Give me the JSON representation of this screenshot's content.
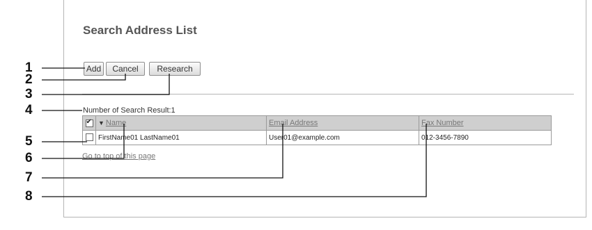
{
  "page": {
    "title": "Search Address List",
    "buttons": {
      "add": "Add",
      "cancel": "Cancel",
      "research": "Research"
    },
    "result_count": "Number of Search Result:1",
    "table": {
      "headers": {
        "name": "Name",
        "email": "Email Address",
        "fax": "Fax Number"
      },
      "rows": [
        {
          "name": "FirstName01 LastName01",
          "email": "User01@example.com",
          "fax": "012-3456-7890"
        }
      ]
    },
    "go_to_top": "Go to top of this page"
  },
  "callouts": [
    "1",
    "2",
    "3",
    "4",
    "5",
    "6",
    "7",
    "8"
  ],
  "colors": {
    "header_bg": "#cfcfcf",
    "border": "#9a9a9a",
    "link": "#777777"
  }
}
